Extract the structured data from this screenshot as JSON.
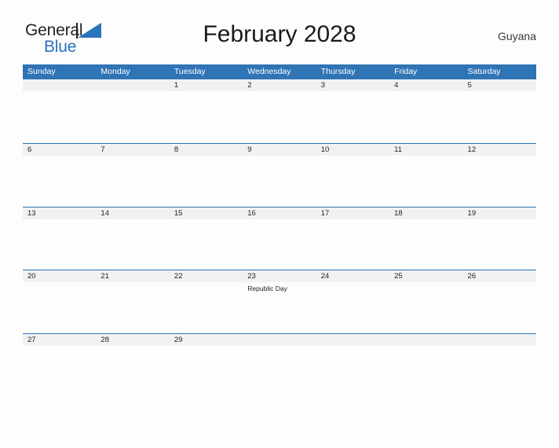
{
  "brand": {
    "name_top": "General",
    "name_bottom": "Blue",
    "accent_color": "#2a74bb",
    "flag_icon": "triangle-flag-icon"
  },
  "header": {
    "title": "February 2028",
    "country": "Guyana"
  },
  "colors": {
    "header_blue": "#2f74b5",
    "band_gray": "#f1f1f1",
    "page_background": "#fdfdfd",
    "text_dark": "#1d1d1d"
  },
  "calendar": {
    "month": "February",
    "year": "2028",
    "day_headers": [
      "Sunday",
      "Monday",
      "Tuesday",
      "Wednesday",
      "Thursday",
      "Friday",
      "Saturday"
    ],
    "weeks": [
      {
        "days": [
          {
            "number": "",
            "event": ""
          },
          {
            "number": "",
            "event": ""
          },
          {
            "number": "1",
            "event": ""
          },
          {
            "number": "2",
            "event": ""
          },
          {
            "number": "3",
            "event": ""
          },
          {
            "number": "4",
            "event": ""
          },
          {
            "number": "5",
            "event": ""
          }
        ]
      },
      {
        "days": [
          {
            "number": "6",
            "event": ""
          },
          {
            "number": "7",
            "event": ""
          },
          {
            "number": "8",
            "event": ""
          },
          {
            "number": "9",
            "event": ""
          },
          {
            "number": "10",
            "event": ""
          },
          {
            "number": "11",
            "event": ""
          },
          {
            "number": "12",
            "event": ""
          }
        ]
      },
      {
        "days": [
          {
            "number": "13",
            "event": ""
          },
          {
            "number": "14",
            "event": ""
          },
          {
            "number": "15",
            "event": ""
          },
          {
            "number": "16",
            "event": ""
          },
          {
            "number": "17",
            "event": ""
          },
          {
            "number": "18",
            "event": ""
          },
          {
            "number": "19",
            "event": ""
          }
        ]
      },
      {
        "days": [
          {
            "number": "20",
            "event": ""
          },
          {
            "number": "21",
            "event": ""
          },
          {
            "number": "22",
            "event": ""
          },
          {
            "number": "23",
            "event": "Republic Day"
          },
          {
            "number": "24",
            "event": ""
          },
          {
            "number": "25",
            "event": ""
          },
          {
            "number": "26",
            "event": ""
          }
        ]
      },
      {
        "days": [
          {
            "number": "27",
            "event": ""
          },
          {
            "number": "28",
            "event": ""
          },
          {
            "number": "29",
            "event": ""
          },
          {
            "number": "",
            "event": ""
          },
          {
            "number": "",
            "event": ""
          },
          {
            "number": "",
            "event": ""
          },
          {
            "number": "",
            "event": ""
          }
        ]
      }
    ]
  }
}
